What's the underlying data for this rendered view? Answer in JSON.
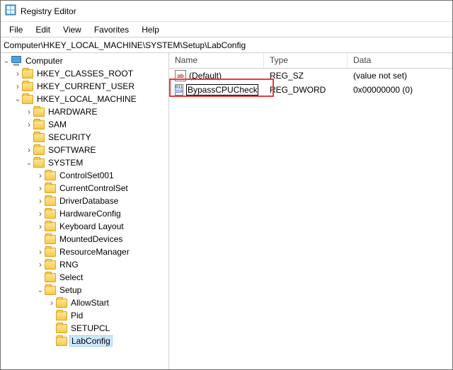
{
  "title": "Registry Editor",
  "menus": {
    "file": "File",
    "edit": "Edit",
    "view": "View",
    "favorites": "Favorites",
    "help": "Help"
  },
  "address": "Computer\\HKEY_LOCAL_MACHINE\\SYSTEM\\Setup\\LabConfig",
  "tree": {
    "computer": "Computer",
    "hkcr": "HKEY_CLASSES_ROOT",
    "hkcu": "HKEY_CURRENT_USER",
    "hklm": "HKEY_LOCAL_MACHINE",
    "hardware": "HARDWARE",
    "sam": "SAM",
    "security": "SECURITY",
    "software": "SOFTWARE",
    "system": "SYSTEM",
    "controlset001": "ControlSet001",
    "currentcontrolset": "CurrentControlSet",
    "driverdatabase": "DriverDatabase",
    "hardwareconfig": "HardwareConfig",
    "keyboardlayout": "Keyboard Layout",
    "mounteddevices": "MountedDevices",
    "resourcemanager": "ResourceManager",
    "rng": "RNG",
    "select": "Select",
    "setup": "Setup",
    "allowstart": "AllowStart",
    "pid": "Pid",
    "setupcl": "SETUPCL",
    "labconfig": "LabConfig"
  },
  "columns": {
    "name": "Name",
    "type": "Type",
    "data": "Data"
  },
  "values": {
    "default": {
      "name": "(Default)",
      "type": "REG_SZ",
      "data": "(value not set)"
    },
    "bypass": {
      "name": "BypassCPUCheck",
      "type": "REG_DWORD",
      "data": "0x00000000 (0)"
    }
  },
  "icons": {
    "sz_glyph": "ab",
    "dw_glyph": "011\n110"
  }
}
